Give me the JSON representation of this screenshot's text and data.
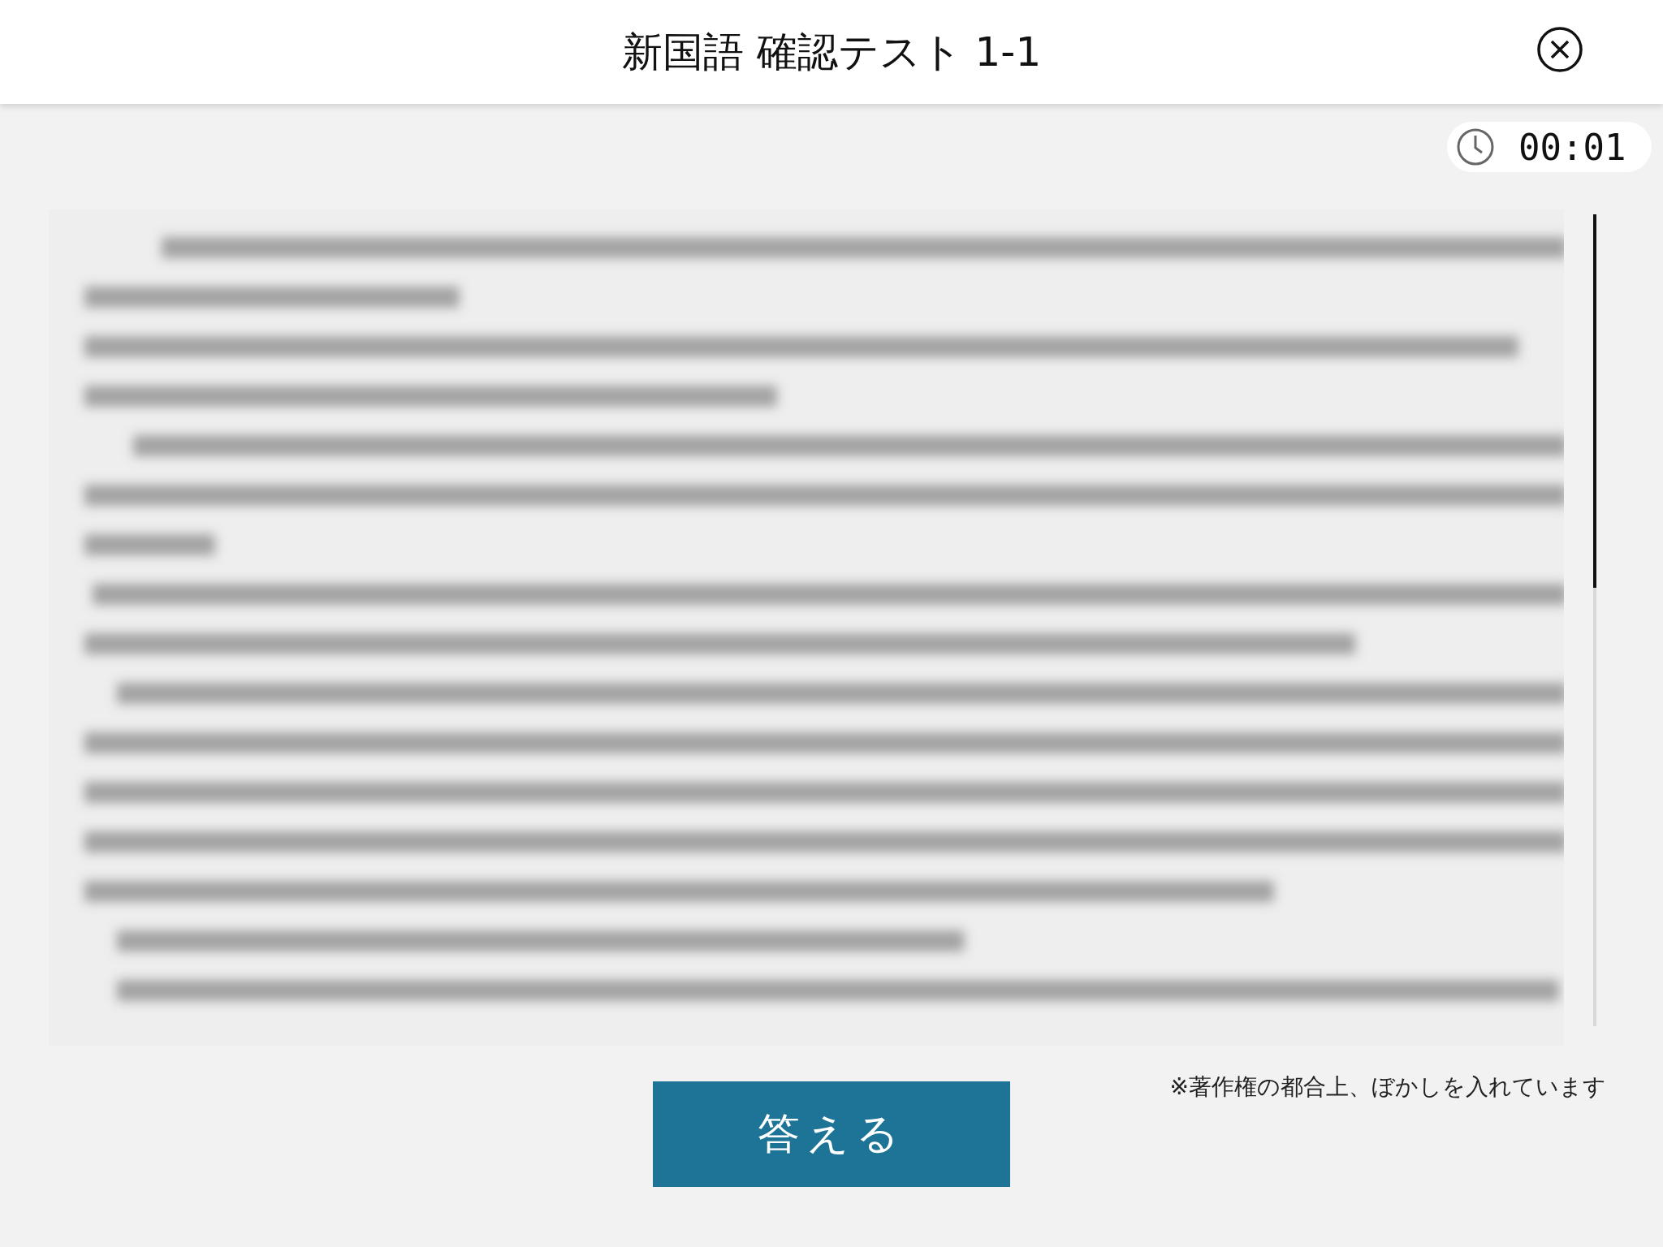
{
  "header": {
    "title": "新国語 確認テスト 1-1"
  },
  "timer": {
    "time": "00:01"
  },
  "note": "※著作権の都合上、ぼかしを入れています",
  "answer_button": {
    "label": "答える"
  }
}
